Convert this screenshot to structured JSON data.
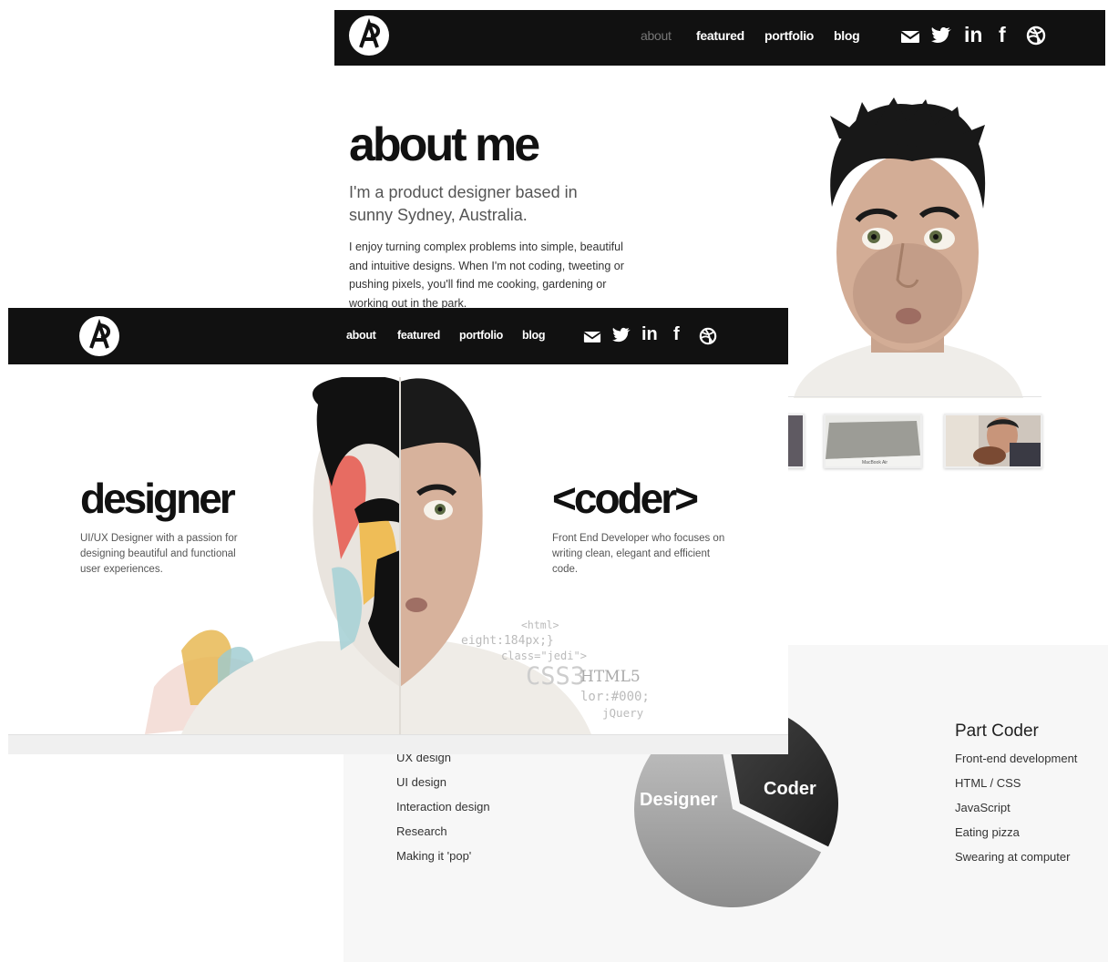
{
  "colors": {
    "nav_bg": "#111111",
    "accent": "#ffffff",
    "pie_designer": "#a8a8a8",
    "pie_coder": "#2e2e2e"
  },
  "nav_a": {
    "links": [
      "about",
      "featured",
      "portfolio",
      "blog"
    ],
    "active": "about",
    "icons": [
      "mail-icon",
      "twitter-icon",
      "linkedin-icon",
      "facebook-icon",
      "dribbble-icon"
    ],
    "linkedin_text": "in",
    "facebook_text": "f"
  },
  "about": {
    "title": "about me",
    "subtitle": "I'm a product designer based in sunny Sydney, Australia.",
    "body": "I enjoy turning complex problems into simple, beautiful and intuitive designs. When I'm not coding, tweeting or pushing pixels, you'll find me cooking, gardening or working out in the park."
  },
  "thumbs": {
    "macbook_caption": "MacBook Air"
  },
  "nav_b": {
    "links": [
      "about",
      "featured",
      "portfolio",
      "blog"
    ],
    "linkedin_text": "in",
    "facebook_text": "f"
  },
  "designer": {
    "title": "designer",
    "description": "UI/UX Designer with a passion for designing beautiful and functional user experiences."
  },
  "coder": {
    "title": "<coder>",
    "description": "Front End Developer who focuses on writing clean, elegant and efficient code."
  },
  "code_snippets": [
    "<html>",
    "eight:184px;}",
    "class=\"jedi\">",
    "CSS3",
    "HTML5",
    "lor:#000;",
    "jQuery"
  ],
  "skills": {
    "designer_items": [
      "UX design",
      "UI design",
      "Interaction design",
      "Research",
      "Making it 'pop'"
    ],
    "coder_heading": "Part Coder",
    "coder_items": [
      "Front-end development",
      "HTML / CSS",
      "JavaScript",
      "Eating pizza",
      "Swearing at computer"
    ]
  },
  "chart_data": {
    "type": "pie",
    "categories": [
      "Designer",
      "Coder"
    ],
    "values": [
      65,
      35
    ],
    "title": "",
    "legend": "none"
  }
}
